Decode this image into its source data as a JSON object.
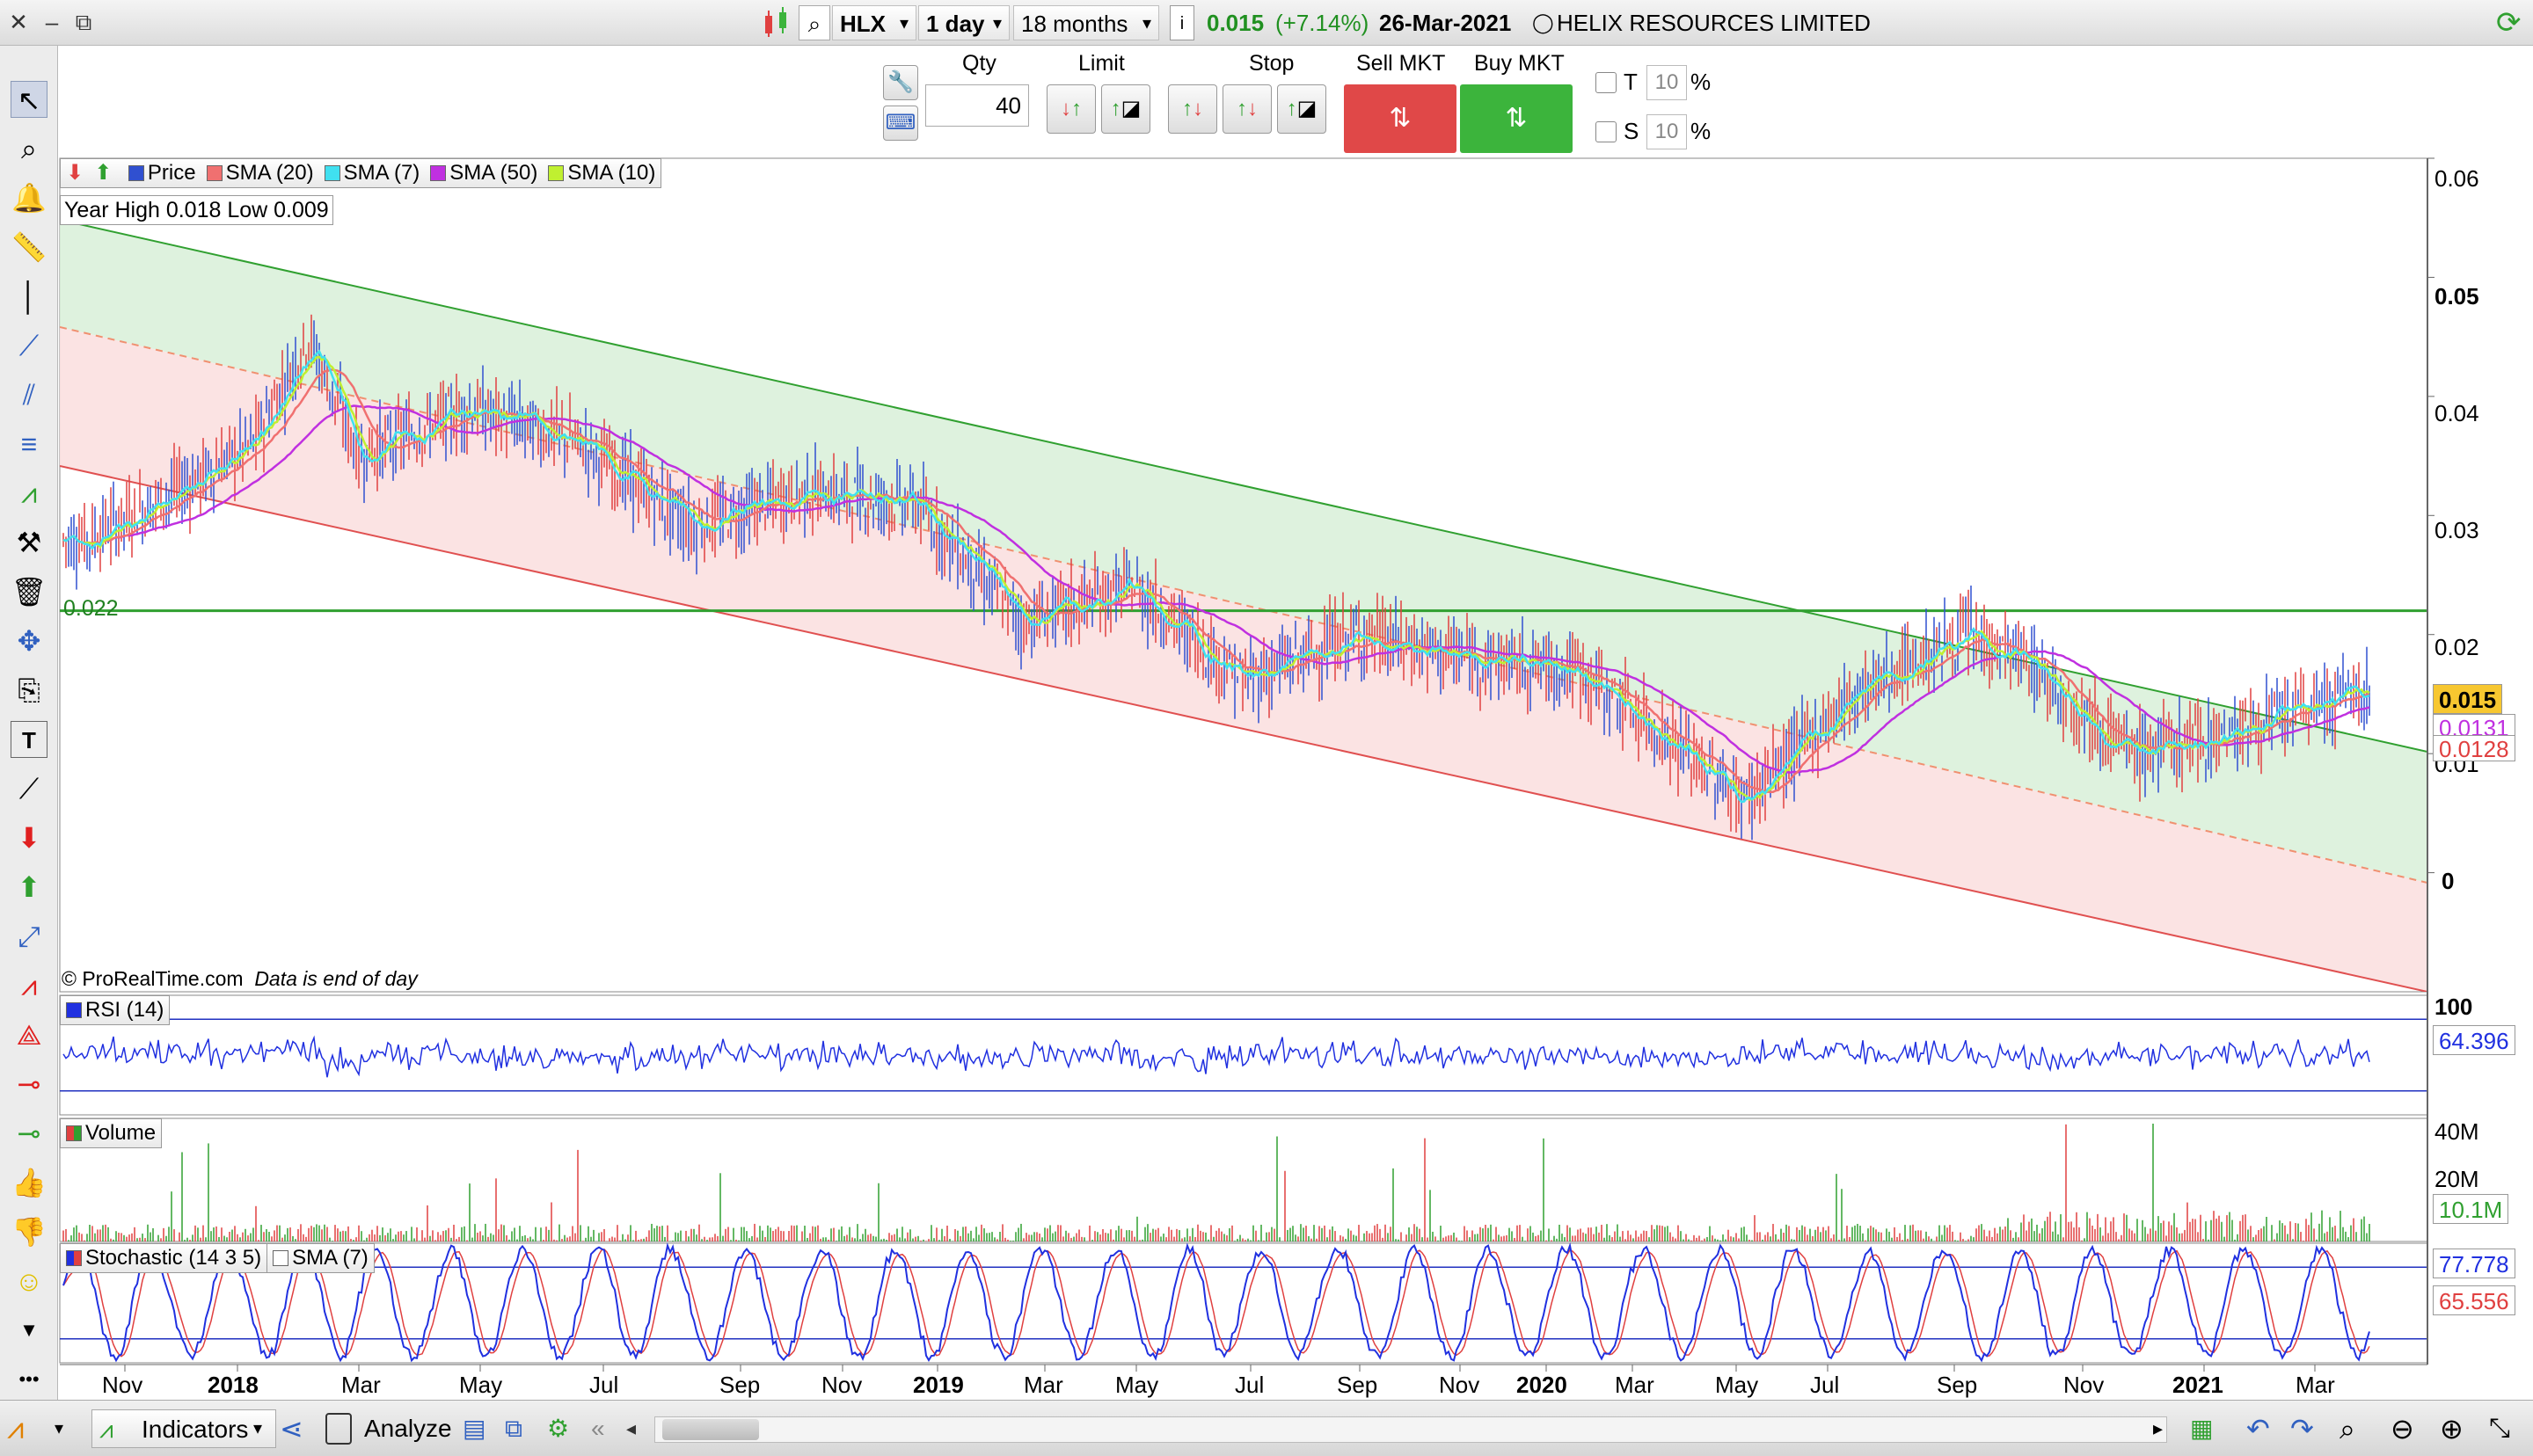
{
  "titlebar": {
    "symbol": "HLX",
    "interval": "1 day",
    "range": "18 months",
    "last_price": "0.015",
    "change": "(+7.14%)",
    "date": "26-Mar-2021",
    "company": "HELIX RESOURCES LIMITED"
  },
  "order": {
    "qty_label": "Qty",
    "qty_value": "40",
    "limit_label": "Limit",
    "stop_label": "Stop",
    "sell_label": "Sell MKT",
    "buy_label": "Buy MKT",
    "t_label": "T",
    "s_label": "S",
    "t_value": "10",
    "s_value": "10",
    "pct": "%"
  },
  "price_panel": {
    "legend": [
      "Price",
      "SMA (20)",
      "SMA (7)",
      "SMA (50)",
      "SMA (10)"
    ],
    "legend_colors": [
      "#3050d0",
      "#f07070",
      "#40e0f0",
      "#c030e0",
      "#c0f030"
    ],
    "year_range": "Year High 0.018 Low 0.009",
    "hline_label": "0.022",
    "copyright": "© ProRealTime.com",
    "data_note": "Data is end of day",
    "y_ticks": [
      "0.06",
      "0.05",
      "0.04",
      "0.03",
      "0.02",
      "0.01",
      "0"
    ],
    "badges": [
      "0.015",
      "0.0131",
      "0.0128"
    ]
  },
  "rsi_panel": {
    "legend": "RSI (14)",
    "y_top": "100",
    "value": "64.396"
  },
  "volume_panel": {
    "legend": "Volume",
    "y_ticks": [
      "40M",
      "20M"
    ],
    "value": "10.1M"
  },
  "stoch_panel": {
    "legend": "Stochastic (14 3 5)",
    "legend2": "SMA (7)",
    "value1": "77.778",
    "value2": "65.556"
  },
  "x_axis": [
    "Nov",
    "2018",
    "Mar",
    "May",
    "Jul",
    "Sep",
    "Nov",
    "2019",
    "Mar",
    "May",
    "Jul",
    "Sep",
    "Nov",
    "2020",
    "Mar",
    "May",
    "Jul",
    "Sep",
    "Nov",
    "2021",
    "Mar"
  ],
  "bottombar": {
    "indicators": "Indicators",
    "analyze": "Analyze"
  },
  "colors": {
    "up_bar": "#3050d0",
    "down_bar": "#e04040",
    "channel_green": "#30a030",
    "channel_red": "#e05050",
    "sell": "#e04848",
    "buy": "#3cb43c"
  },
  "chart_data": {
    "type": "line",
    "title": "HLX",
    "x_range": [
      "2017-10-01",
      "2021-03-26"
    ],
    "ylim": [
      -0.01,
      0.06
    ],
    "price_approx": {
      "x": [
        "2017-10",
        "2017-12",
        "2018-01",
        "2018-02",
        "2018-03",
        "2018-05",
        "2018-07",
        "2018-09",
        "2018-11",
        "2019-01",
        "2019-03",
        "2019-05",
        "2019-07",
        "2019-09",
        "2019-11",
        "2020-01",
        "2020-03",
        "2020-04",
        "2020-06",
        "2020-08",
        "2020-09",
        "2020-11",
        "2021-01",
        "2021-03"
      ],
      "y": [
        0.028,
        0.033,
        0.036,
        0.045,
        0.035,
        0.039,
        0.036,
        0.029,
        0.032,
        0.031,
        0.021,
        0.024,
        0.016,
        0.02,
        0.018,
        0.017,
        0.01,
        0.006,
        0.015,
        0.02,
        0.018,
        0.01,
        0.012,
        0.015
      ]
    },
    "hline": 0.022,
    "grid": false,
    "legend": "top-left"
  }
}
